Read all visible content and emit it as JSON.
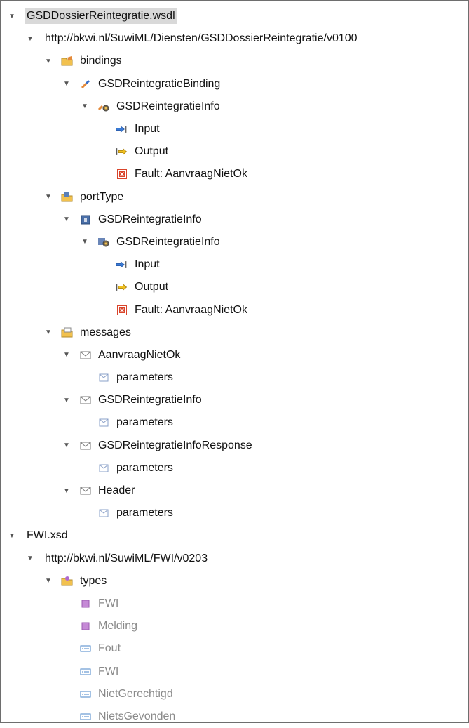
{
  "tree": [
    {
      "label": "GSDDossierReintegratie.wsdl",
      "level": 0,
      "expanded": true,
      "icon": null,
      "selected": true
    },
    {
      "label": "http://bkwi.nl/SuwiML/Diensten/GSDDossierReintegratie/v0100",
      "level": 1,
      "expanded": true,
      "icon": null
    },
    {
      "label": "bindings",
      "level": 2,
      "expanded": true,
      "icon": "folder-bindings-icon"
    },
    {
      "label": "GSDReintegratieBinding",
      "level": 3,
      "expanded": true,
      "icon": "binding-icon"
    },
    {
      "label": "GSDReintegratieInfo",
      "level": 4,
      "expanded": true,
      "icon": "binding-operation-icon"
    },
    {
      "label": "Input",
      "level": 5,
      "expanded": null,
      "icon": "input-icon"
    },
    {
      "label": "Output",
      "level": 5,
      "expanded": null,
      "icon": "output-icon"
    },
    {
      "label": "Fault: AanvraagNietOk",
      "level": 5,
      "expanded": null,
      "icon": "fault-icon"
    },
    {
      "label": "portType",
      "level": 2,
      "expanded": true,
      "icon": "folder-porttype-icon"
    },
    {
      "label": "GSDReintegratieInfo",
      "level": 3,
      "expanded": true,
      "icon": "porttype-icon"
    },
    {
      "label": "GSDReintegratieInfo",
      "level": 4,
      "expanded": true,
      "icon": "operation-icon"
    },
    {
      "label": "Input",
      "level": 5,
      "expanded": null,
      "icon": "input-icon"
    },
    {
      "label": "Output",
      "level": 5,
      "expanded": null,
      "icon": "output-icon"
    },
    {
      "label": "Fault: AanvraagNietOk",
      "level": 5,
      "expanded": null,
      "icon": "fault-icon"
    },
    {
      "label": "messages",
      "level": 2,
      "expanded": true,
      "icon": "folder-messages-icon"
    },
    {
      "label": "AanvraagNietOk",
      "level": 3,
      "expanded": true,
      "icon": "message-icon"
    },
    {
      "label": "parameters",
      "level": 4,
      "expanded": null,
      "icon": "part-icon"
    },
    {
      "label": "GSDReintegratieInfo",
      "level": 3,
      "expanded": true,
      "icon": "message-icon"
    },
    {
      "label": "parameters",
      "level": 4,
      "expanded": null,
      "icon": "part-icon"
    },
    {
      "label": "GSDReintegratieInfoResponse",
      "level": 3,
      "expanded": true,
      "icon": "message-icon"
    },
    {
      "label": "parameters",
      "level": 4,
      "expanded": null,
      "icon": "part-icon"
    },
    {
      "label": "Header",
      "level": 3,
      "expanded": true,
      "icon": "message-icon"
    },
    {
      "label": "parameters",
      "level": 4,
      "expanded": null,
      "icon": "part-icon"
    },
    {
      "label": "FWI.xsd",
      "level": 0,
      "expanded": true,
      "icon": null
    },
    {
      "label": "http://bkwi.nl/SuwiML/FWI/v0203",
      "level": 1,
      "expanded": true,
      "icon": null
    },
    {
      "label": "types",
      "level": 2,
      "expanded": true,
      "icon": "folder-types-icon"
    },
    {
      "label": "FWI",
      "level": 3,
      "expanded": null,
      "icon": "element-icon",
      "dim": true
    },
    {
      "label": "Melding",
      "level": 3,
      "expanded": null,
      "icon": "element-icon",
      "dim": true
    },
    {
      "label": "Fout",
      "level": 3,
      "expanded": null,
      "icon": "complex-type-icon",
      "dim": true
    },
    {
      "label": "FWI",
      "level": 3,
      "expanded": null,
      "icon": "complex-type-icon",
      "dim": true
    },
    {
      "label": "NietGerechtigd",
      "level": 3,
      "expanded": null,
      "icon": "complex-type-icon",
      "dim": true
    },
    {
      "label": "NietsGevonden",
      "level": 3,
      "expanded": null,
      "icon": "complex-type-icon",
      "dim": true
    }
  ],
  "colors": {
    "selection": "#d9d9d9",
    "folder": "#f2c14e",
    "dimText": "#8a8a8a",
    "arrowBlue": "#3a7bd5",
    "outputYellow": "#f0c020",
    "faultRed": "#d9442b",
    "elementPurple": "#c58ad6",
    "complexBlue": "#4a86c8"
  }
}
